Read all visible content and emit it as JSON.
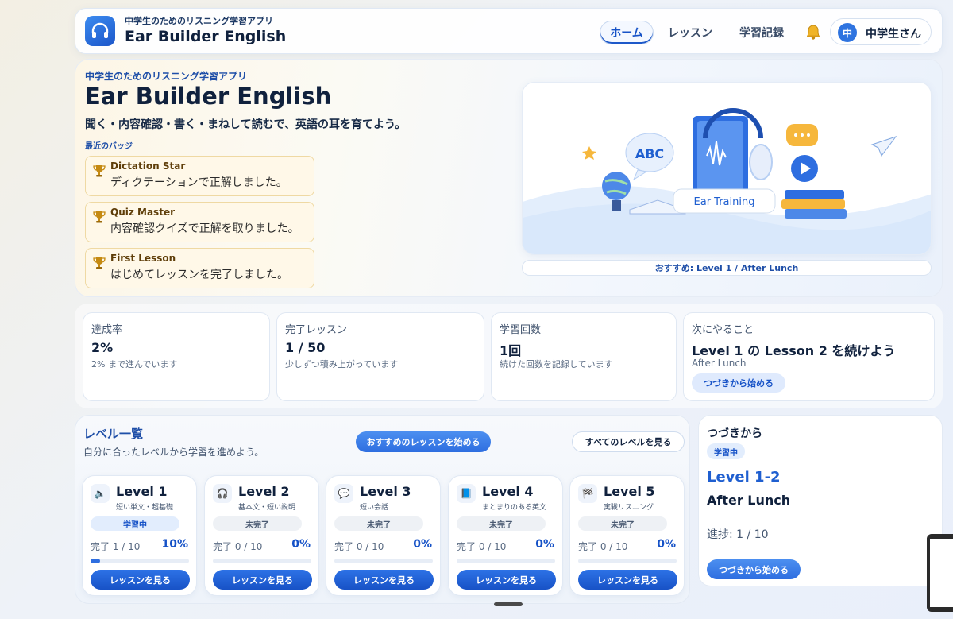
{
  "header": {
    "subtitle": "中学生のためのリスニング学習アプリ",
    "title": "Ear Builder English",
    "nav": [
      "ホーム",
      "レッスン",
      "学習記録"
    ],
    "user_initial": "中",
    "user_name": "中学生さん"
  },
  "hero": {
    "subtitle": "中学生のためのリスニング学習アプリ",
    "title": "Ear Builder English",
    "tagline": "聞く・内容確認・書く・まねして読むで、英語の耳を育てよう。",
    "badges_label": "最近のバッジ",
    "badges": [
      {
        "name": "Dictation Star",
        "desc": "ディクテーションで正解しました。"
      },
      {
        "name": "Quiz Master",
        "desc": "内容確認クイズで正解を取りました。"
      },
      {
        "name": "First Lesson",
        "desc": "はじめてレッスンを完了しました。"
      }
    ],
    "illustration": {
      "abc": "ABC",
      "label": "Ear Training"
    },
    "recommend": "おすすめ: Level 1 / After Lunch"
  },
  "stats": [
    {
      "label": "達成率",
      "value": "2%",
      "desc": "2% まで進んでいます"
    },
    {
      "label": "完了レッスン",
      "value": "1 / 50",
      "desc": "少しずつ積み上がっています"
    },
    {
      "label": "学習回数",
      "value": "1回",
      "desc": "続けた回数を記録しています"
    },
    {
      "label": "次にやること",
      "value": "Level 1 の Lesson 2 を続けよう",
      "desc": "After Lunch",
      "button": "つづきから始める"
    }
  ],
  "levels_section": {
    "title": "レベル一覧",
    "desc": "自分に合ったレベルから学習を進めよう。",
    "start_button": "おすすめのレッスンを始める",
    "all_button": "すべてのレベルを見る",
    "levels": [
      {
        "icon": "🔈",
        "name": "Level 1",
        "sub": "短い単文・超基礎",
        "status": "学習中",
        "done": "完了 1 / 10",
        "percent": "10%",
        "progress": 0.1,
        "button": "レッスンを見る"
      },
      {
        "icon": "🎧",
        "name": "Level 2",
        "sub": "基本文・短い説明",
        "status": "未完了",
        "done": "完了 0 / 10",
        "percent": "0%",
        "progress": 0,
        "button": "レッスンを見る"
      },
      {
        "icon": "💬",
        "name": "Level 3",
        "sub": "短い会話",
        "status": "未完了",
        "done": "完了 0 / 10",
        "percent": "0%",
        "progress": 0,
        "button": "レッスンを見る"
      },
      {
        "icon": "📘",
        "name": "Level 4",
        "sub": "まとまりのある英文",
        "status": "未完了",
        "done": "完了 0 / 10",
        "percent": "0%",
        "progress": 0,
        "button": "レッスンを見る"
      },
      {
        "icon": "🏁",
        "name": "Level 5",
        "sub": "実戦リスニング",
        "status": "未完了",
        "done": "完了 0 / 10",
        "percent": "0%",
        "progress": 0,
        "button": "レッスンを見る"
      }
    ]
  },
  "continue": {
    "title": "つづきから",
    "chip": "学習中",
    "level": "Level 1-2",
    "lesson": "After Lunch",
    "progress": "進捗: 1 / 10",
    "button": "つづきから始める"
  },
  "colors": {
    "accent": "#1652c7",
    "gold": "#c58a12",
    "active_status_bg": "#e2edfd",
    "inactive_status_bg": "#eef1f5"
  }
}
